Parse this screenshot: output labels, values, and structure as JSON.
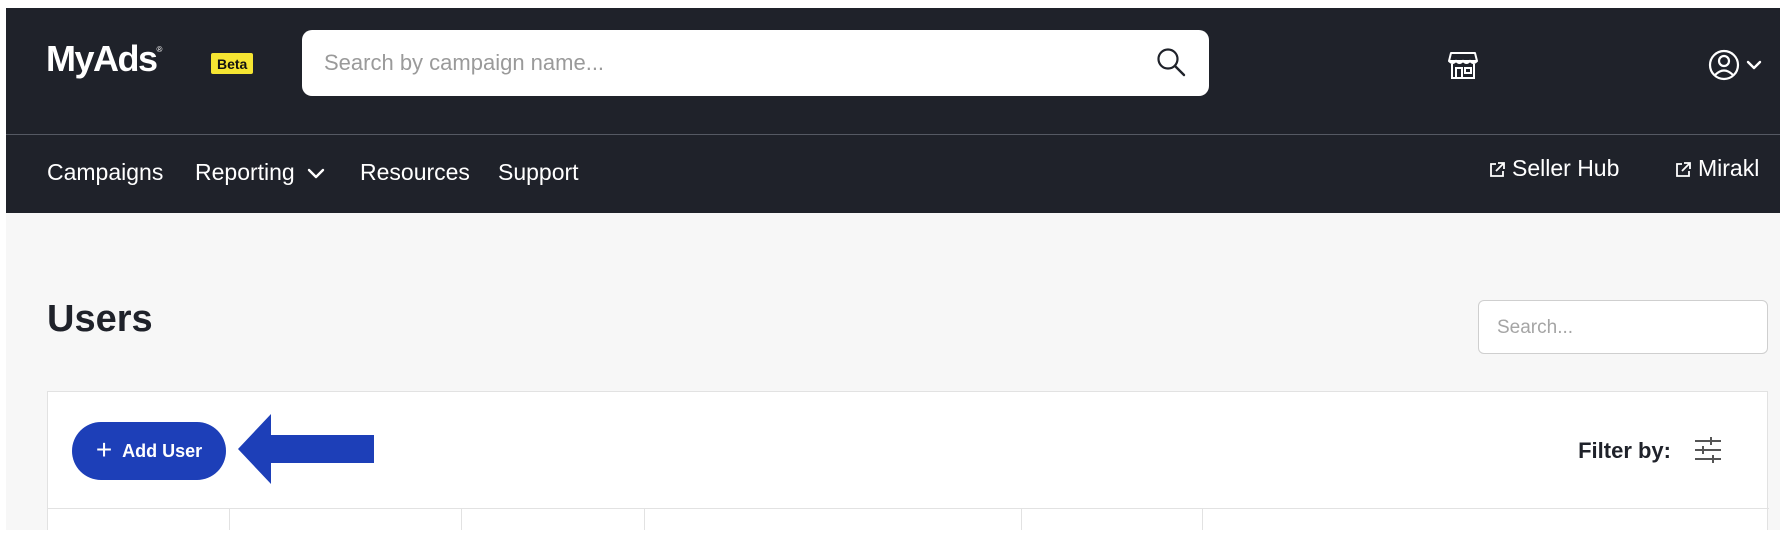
{
  "brand": {
    "logo_text": "MyAds",
    "logo_mark": "®",
    "beta_badge": "Beta"
  },
  "header": {
    "search_placeholder": "Search by campaign name...",
    "store_icon": "store-icon",
    "account_icon": "account-circle-icon"
  },
  "nav": {
    "items": [
      {
        "label": "Campaigns"
      },
      {
        "label": "Reporting",
        "has_dropdown": true
      },
      {
        "label": "Resources"
      },
      {
        "label": "Support"
      }
    ],
    "external_links": [
      {
        "label": "Seller Hub",
        "icon": "external-link-icon"
      },
      {
        "label": "Mirakl",
        "icon": "external-link-icon"
      }
    ]
  },
  "page": {
    "title": "Users",
    "search_placeholder": "Search...",
    "add_user_label": "Add User",
    "filter_label": "Filter by:"
  },
  "colors": {
    "header_bg": "#1f222a",
    "beta_bg": "#f5e532",
    "primary_button": "#1d3fb8",
    "annotation_arrow": "#1d3fb8",
    "page_bg": "#f7f7f7"
  }
}
